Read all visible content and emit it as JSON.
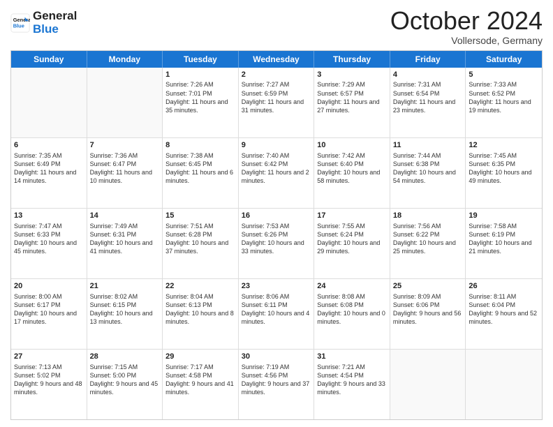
{
  "header": {
    "logo_line1": "General",
    "logo_line2": "Blue",
    "month": "October 2024",
    "location": "Vollersode, Germany"
  },
  "weekdays": [
    "Sunday",
    "Monday",
    "Tuesday",
    "Wednesday",
    "Thursday",
    "Friday",
    "Saturday"
  ],
  "weeks": [
    [
      {
        "day": "",
        "info": ""
      },
      {
        "day": "",
        "info": ""
      },
      {
        "day": "1",
        "info": "Sunrise: 7:26 AM\nSunset: 7:01 PM\nDaylight: 11 hours and 35 minutes."
      },
      {
        "day": "2",
        "info": "Sunrise: 7:27 AM\nSunset: 6:59 PM\nDaylight: 11 hours and 31 minutes."
      },
      {
        "day": "3",
        "info": "Sunrise: 7:29 AM\nSunset: 6:57 PM\nDaylight: 11 hours and 27 minutes."
      },
      {
        "day": "4",
        "info": "Sunrise: 7:31 AM\nSunset: 6:54 PM\nDaylight: 11 hours and 23 minutes."
      },
      {
        "day": "5",
        "info": "Sunrise: 7:33 AM\nSunset: 6:52 PM\nDaylight: 11 hours and 19 minutes."
      }
    ],
    [
      {
        "day": "6",
        "info": "Sunrise: 7:35 AM\nSunset: 6:49 PM\nDaylight: 11 hours and 14 minutes."
      },
      {
        "day": "7",
        "info": "Sunrise: 7:36 AM\nSunset: 6:47 PM\nDaylight: 11 hours and 10 minutes."
      },
      {
        "day": "8",
        "info": "Sunrise: 7:38 AM\nSunset: 6:45 PM\nDaylight: 11 hours and 6 minutes."
      },
      {
        "day": "9",
        "info": "Sunrise: 7:40 AM\nSunset: 6:42 PM\nDaylight: 11 hours and 2 minutes."
      },
      {
        "day": "10",
        "info": "Sunrise: 7:42 AM\nSunset: 6:40 PM\nDaylight: 10 hours and 58 minutes."
      },
      {
        "day": "11",
        "info": "Sunrise: 7:44 AM\nSunset: 6:38 PM\nDaylight: 10 hours and 54 minutes."
      },
      {
        "day": "12",
        "info": "Sunrise: 7:45 AM\nSunset: 6:35 PM\nDaylight: 10 hours and 49 minutes."
      }
    ],
    [
      {
        "day": "13",
        "info": "Sunrise: 7:47 AM\nSunset: 6:33 PM\nDaylight: 10 hours and 45 minutes."
      },
      {
        "day": "14",
        "info": "Sunrise: 7:49 AM\nSunset: 6:31 PM\nDaylight: 10 hours and 41 minutes."
      },
      {
        "day": "15",
        "info": "Sunrise: 7:51 AM\nSunset: 6:28 PM\nDaylight: 10 hours and 37 minutes."
      },
      {
        "day": "16",
        "info": "Sunrise: 7:53 AM\nSunset: 6:26 PM\nDaylight: 10 hours and 33 minutes."
      },
      {
        "day": "17",
        "info": "Sunrise: 7:55 AM\nSunset: 6:24 PM\nDaylight: 10 hours and 29 minutes."
      },
      {
        "day": "18",
        "info": "Sunrise: 7:56 AM\nSunset: 6:22 PM\nDaylight: 10 hours and 25 minutes."
      },
      {
        "day": "19",
        "info": "Sunrise: 7:58 AM\nSunset: 6:19 PM\nDaylight: 10 hours and 21 minutes."
      }
    ],
    [
      {
        "day": "20",
        "info": "Sunrise: 8:00 AM\nSunset: 6:17 PM\nDaylight: 10 hours and 17 minutes."
      },
      {
        "day": "21",
        "info": "Sunrise: 8:02 AM\nSunset: 6:15 PM\nDaylight: 10 hours and 13 minutes."
      },
      {
        "day": "22",
        "info": "Sunrise: 8:04 AM\nSunset: 6:13 PM\nDaylight: 10 hours and 8 minutes."
      },
      {
        "day": "23",
        "info": "Sunrise: 8:06 AM\nSunset: 6:11 PM\nDaylight: 10 hours and 4 minutes."
      },
      {
        "day": "24",
        "info": "Sunrise: 8:08 AM\nSunset: 6:08 PM\nDaylight: 10 hours and 0 minutes."
      },
      {
        "day": "25",
        "info": "Sunrise: 8:09 AM\nSunset: 6:06 PM\nDaylight: 9 hours and 56 minutes."
      },
      {
        "day": "26",
        "info": "Sunrise: 8:11 AM\nSunset: 6:04 PM\nDaylight: 9 hours and 52 minutes."
      }
    ],
    [
      {
        "day": "27",
        "info": "Sunrise: 7:13 AM\nSunset: 5:02 PM\nDaylight: 9 hours and 48 minutes."
      },
      {
        "day": "28",
        "info": "Sunrise: 7:15 AM\nSunset: 5:00 PM\nDaylight: 9 hours and 45 minutes."
      },
      {
        "day": "29",
        "info": "Sunrise: 7:17 AM\nSunset: 4:58 PM\nDaylight: 9 hours and 41 minutes."
      },
      {
        "day": "30",
        "info": "Sunrise: 7:19 AM\nSunset: 4:56 PM\nDaylight: 9 hours and 37 minutes."
      },
      {
        "day": "31",
        "info": "Sunrise: 7:21 AM\nSunset: 4:54 PM\nDaylight: 9 hours and 33 minutes."
      },
      {
        "day": "",
        "info": ""
      },
      {
        "day": "",
        "info": ""
      }
    ]
  ]
}
